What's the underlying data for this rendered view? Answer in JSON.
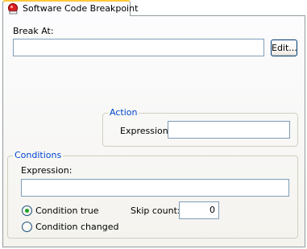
{
  "tab": {
    "title": "Software Code Breakpoint",
    "icon": "breakpoint-icon"
  },
  "break_at": {
    "label": "Break At:",
    "value": "",
    "edit_button": "Edit..."
  },
  "action": {
    "legend": "Action",
    "expression_label": "Expression:",
    "expression_value": ""
  },
  "conditions": {
    "legend": "Conditions",
    "expression_label": "Expression:",
    "expression_value": "",
    "options": [
      {
        "label": "Condition true",
        "checked": true
      },
      {
        "label": "Condition changed",
        "checked": false
      }
    ],
    "skip_count_label": "Skip count:",
    "skip_count_value": "0"
  },
  "colors": {
    "tab_accent": "#ffc83c",
    "legend_text": "#0046d5",
    "input_border": "#7f9db9",
    "button_border": "#003c74",
    "radio_dot": "#21a121"
  }
}
